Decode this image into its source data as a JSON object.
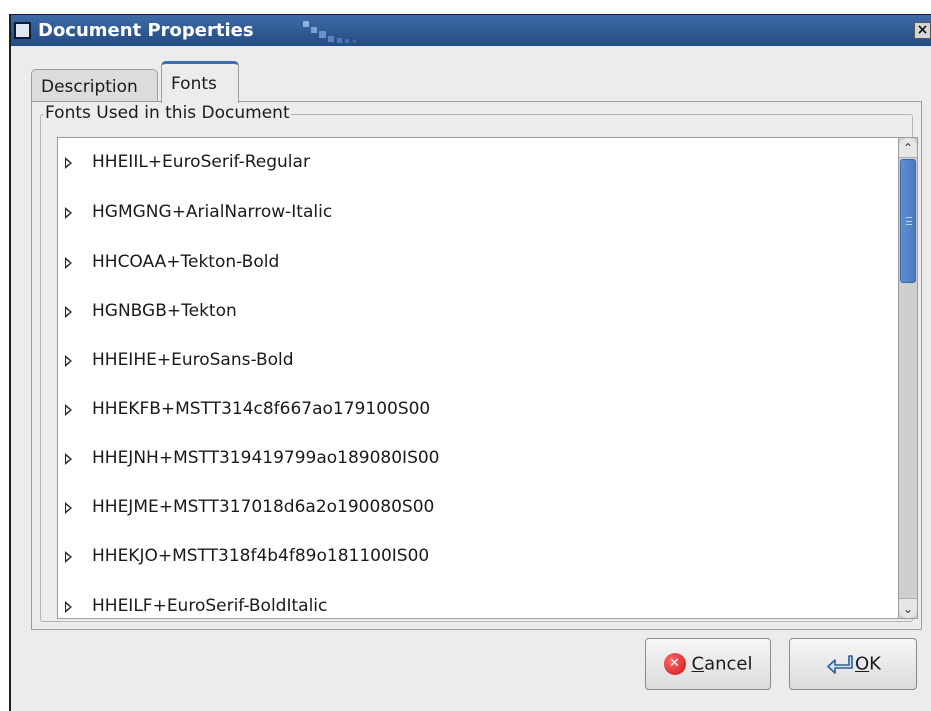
{
  "window": {
    "title": "Document Properties",
    "close_glyph": "×"
  },
  "tabs": [
    {
      "label": "Description",
      "active": false
    },
    {
      "label": "Fonts",
      "active": true
    }
  ],
  "fonts_frame": {
    "label": "Fonts Used in this Document",
    "items": [
      "HHEIIL+EuroSerif-Regular",
      "HGMGNG+ArialNarrow-Italic",
      "HHCOAA+Tekton-Bold",
      "HGNBGB+Tekton",
      "HHEIHE+EuroSans-Bold",
      "HHEKFB+MSTT314c8f667ao179100S00",
      "HHEJNH+MSTT319419799ao189080IS00",
      "HHEJME+MSTT317018d6a2o190080S00",
      "HHEKJO+MSTT318f4b4f89o181100IS00",
      "HHEILF+EuroSerif-BoldItalic"
    ]
  },
  "buttons": {
    "cancel": {
      "mnemonic": "C",
      "rest": "ancel",
      "icon": "cancel-icon"
    },
    "ok": {
      "mnemonic": "O",
      "rest": "K",
      "icon": "return-arrow-icon"
    }
  },
  "colors": {
    "titlebar": "#2f5a94",
    "active_tab_accent": "#3b6db3",
    "scroll_thumb": "#4a7cc0",
    "cancel_icon": "#cc1111"
  }
}
